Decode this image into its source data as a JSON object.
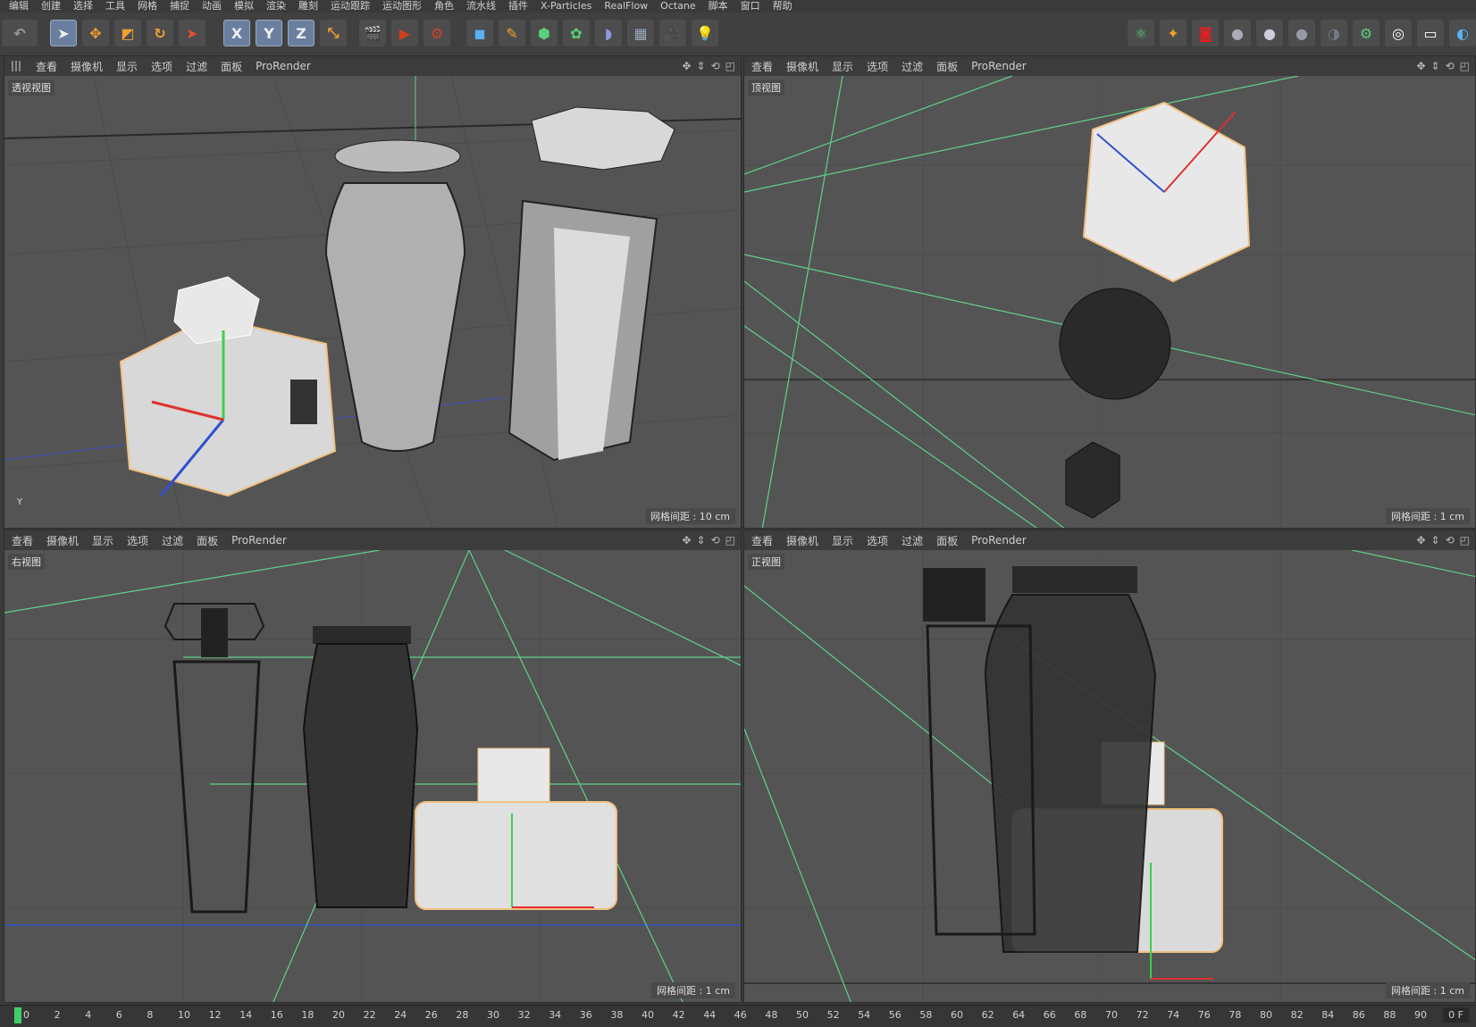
{
  "menu": [
    "编辑",
    "创建",
    "选择",
    "工具",
    "网格",
    "捕捉",
    "动画",
    "模拟",
    "渲染",
    "雕刻",
    "运动跟踪",
    "运动图形",
    "角色",
    "流水线",
    "插件",
    "X-Particles",
    "RealFlow",
    "Octane",
    "脚本",
    "窗口",
    "帮助"
  ],
  "toolbar": {
    "axis_x": "X",
    "axis_y": "Y",
    "axis_z": "Z"
  },
  "viewport_menu": [
    "查看",
    "摄像机",
    "显示",
    "选项",
    "过滤",
    "面板",
    "ProRender"
  ],
  "viewports": {
    "perspective": {
      "label": "透视视图",
      "grid": "网格间距 : 10 cm"
    },
    "top": {
      "label": "顶视图",
      "grid": "网格间距 : 1 cm"
    },
    "right": {
      "label": "右视图",
      "grid": "网格间距 : 1 cm"
    },
    "front": {
      "label": "正视图",
      "grid": "网格间距 : 1 cm"
    }
  },
  "timeline": {
    "ticks": [
      "0",
      "2",
      "4",
      "6",
      "8",
      "10",
      "12",
      "14",
      "16",
      "18",
      "20",
      "22",
      "24",
      "26",
      "28",
      "30",
      "32",
      "34",
      "36",
      "38",
      "40",
      "42",
      "44",
      "46",
      "48",
      "50",
      "52",
      "54",
      "56",
      "58",
      "60",
      "62",
      "64",
      "66",
      "68",
      "70",
      "72",
      "74",
      "76",
      "78",
      "80",
      "82",
      "84",
      "86",
      "88",
      "90"
    ],
    "current_frame": "0 F"
  },
  "colors": {
    "accent": "#6a7fa0",
    "grid_line": "#5fd08a",
    "selection": "#f0c080"
  }
}
